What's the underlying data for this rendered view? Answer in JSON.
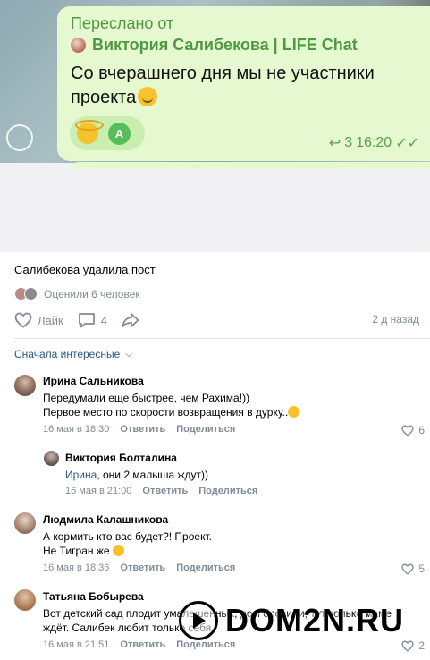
{
  "forwarded_message": {
    "forwarded_label": "Переслано от",
    "author": "Виктория Салибекова | LIFE Chat",
    "text": "Со вчерашнего дня мы не участники проекта",
    "reaction_avatar_letter": "А",
    "forward_count": "3",
    "time": "16:20",
    "accent_color": "#4f9a40",
    "bubble_color": "#e5f8cf"
  },
  "post": {
    "text": "Салибекова удалила пост",
    "liked_by": "Оценили 6 человек",
    "like_label": "Лайк",
    "comments_count": "4",
    "time_ago": "2 д назад"
  },
  "comments_sort": "Сначала интересные",
  "comments": [
    {
      "author": "Ирина Сальникова",
      "line1": "Передумали еще быстрее, чем Рахима!))",
      "line2": "Первое место по скорости возвращения в дурку..",
      "date": "16 мая в 18:30",
      "reply_label": "Ответить",
      "share_label": "Поделиться",
      "likes": "6"
    },
    {
      "author": "Виктория Болталина",
      "reply_to": "Ирина",
      "line1": ", они 2 малыша ждут))",
      "date": "16 мая в 21:00",
      "reply_label": "Ответить",
      "share_label": "Поделиться"
    },
    {
      "author": "Людмила Калашникова",
      "line1": "А кормить кто вас будет?! Проект.",
      "line2": "Не Тигран же",
      "date": "16 мая в 18:36",
      "reply_label": "Ответить",
      "share_label": "Поделиться",
      "likes": "5"
    },
    {
      "author": "Татьяна Бобырева",
      "line1": "Вот детский сад плодит умалешенных, дом бросили, тут только маме",
      "line2": "ждёт. Салибек любит только себя.",
      "date": "16 мая в 21:51",
      "reply_label": "Ответить",
      "share_label": "Поделиться",
      "likes": "2"
    }
  ],
  "watermark": "DOM2N.RU",
  "colors": {
    "link": "#2a5885",
    "secondary": "#818c99"
  }
}
